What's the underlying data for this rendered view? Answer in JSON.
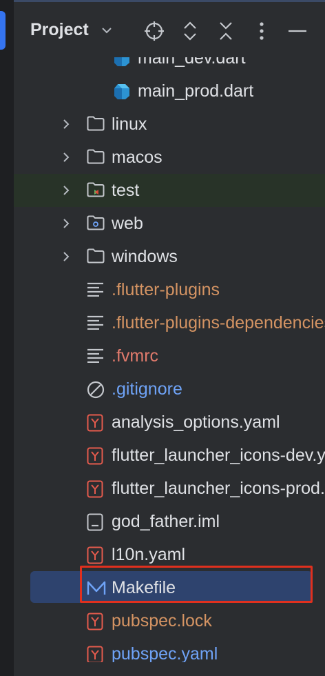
{
  "panel": {
    "title": "Project"
  },
  "header_icons": [
    "locate-icon",
    "expand-collapse-icon",
    "collapse-all-icon",
    "more-icon",
    "minimize-icon"
  ],
  "colors": {
    "default": "#dfe1e5",
    "orange": "#d59463",
    "red": "#e07a6c",
    "blue": "#6fa3f7",
    "selection": "#2e436e",
    "highlight": "#e0301e"
  },
  "items": [
    {
      "label": "main_dev.dart",
      "icon": "dart-file-icon",
      "color": "default"
    },
    {
      "label": "main_prod.dart",
      "icon": "dart-file-icon",
      "color": "default"
    },
    {
      "label": "linux",
      "icon": "folder-icon",
      "color": "default",
      "expandable": true
    },
    {
      "label": "macos",
      "icon": "folder-icon",
      "color": "default",
      "expandable": true
    },
    {
      "label": "test",
      "icon": "test-folder-icon",
      "color": "default",
      "expandable": true
    },
    {
      "label": "web",
      "icon": "web-folder-icon",
      "color": "default",
      "expandable": true
    },
    {
      "label": "windows",
      "icon": "folder-icon",
      "color": "default",
      "expandable": true
    },
    {
      "label": ".flutter-plugins",
      "icon": "text-file-icon",
      "color": "orange"
    },
    {
      "label": ".flutter-plugins-dependencies",
      "icon": "text-file-icon",
      "color": "orange"
    },
    {
      "label": ".fvmrc",
      "icon": "text-file-icon",
      "color": "red"
    },
    {
      "label": ".gitignore",
      "icon": "ignore-file-icon",
      "color": "blue"
    },
    {
      "label": "analysis_options.yaml",
      "icon": "yaml-file-icon",
      "color": "default"
    },
    {
      "label": "flutter_launcher_icons-dev.yaml",
      "icon": "yaml-file-icon",
      "color": "default"
    },
    {
      "label": "flutter_launcher_icons-prod.yaml",
      "icon": "yaml-file-icon",
      "color": "default"
    },
    {
      "label": "god_father.iml",
      "icon": "iml-file-icon",
      "color": "default"
    },
    {
      "label": "l10n.yaml",
      "icon": "yaml-file-icon",
      "color": "default"
    },
    {
      "label": "Makefile",
      "icon": "makefile-icon",
      "color": "default",
      "selected": true
    },
    {
      "label": "pubspec.lock",
      "icon": "yaml-file-icon",
      "color": "orange"
    },
    {
      "label": "pubspec.yaml",
      "icon": "yaml-file-icon",
      "color": "blue"
    }
  ]
}
